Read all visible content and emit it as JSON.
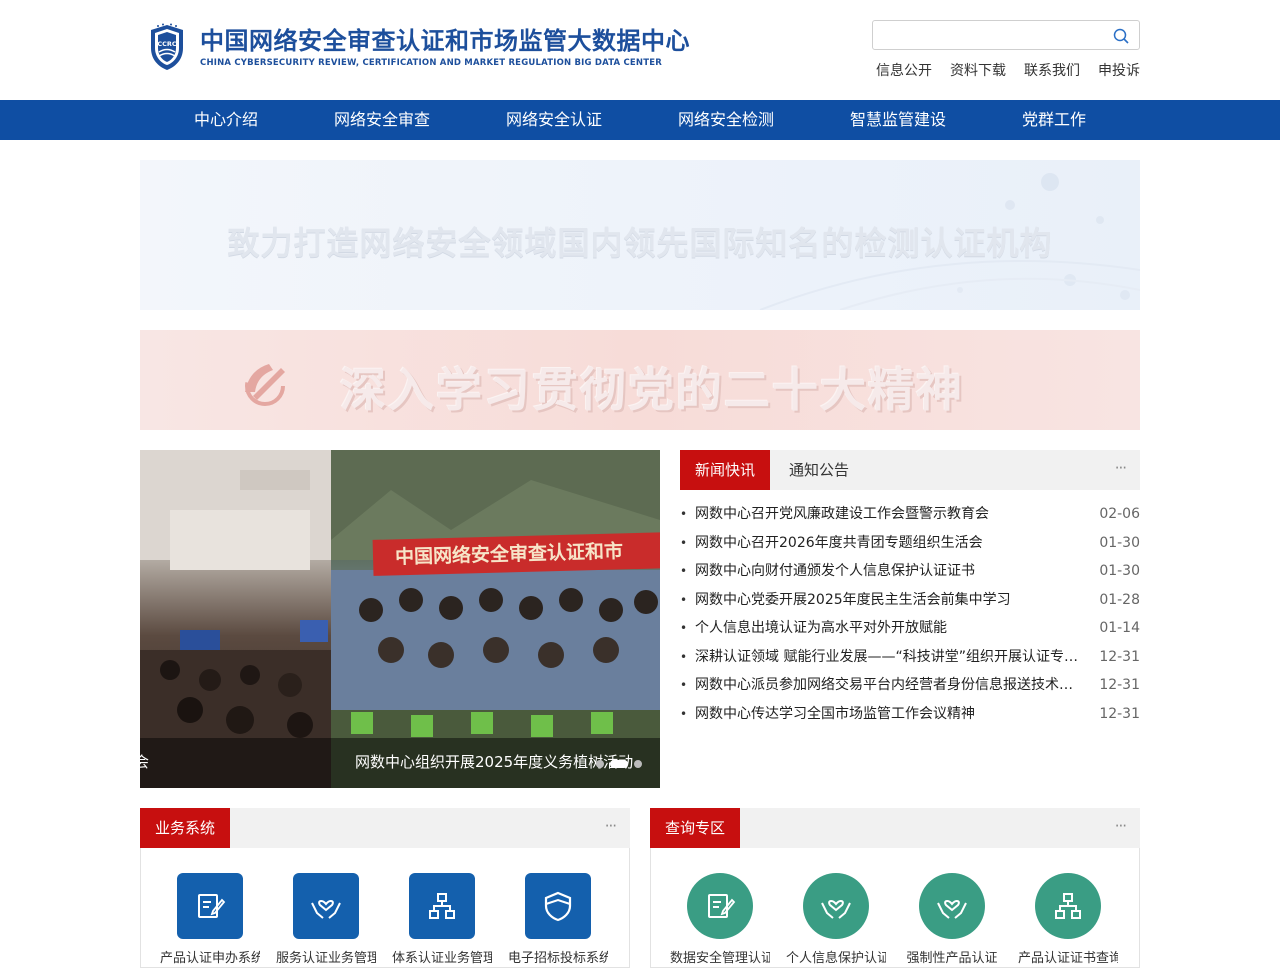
{
  "header": {
    "title_cn": "中国网络安全审查认证和市场监管大数据中心",
    "title_en": "CHINA CYBERSECURITY REVIEW, CERTIFICATION AND MARKET REGULATION BIG DATA CENTER",
    "logo_text": "CCRC",
    "search_placeholder": "",
    "top_links": [
      "信息公开",
      "资料下载",
      "联系我们",
      "申投诉"
    ]
  },
  "nav": [
    "中心介绍",
    "网络安全审查",
    "网络安全认证",
    "网络安全检测",
    "智慧监管建设",
    "党群工作"
  ],
  "banners": {
    "banner1_text": "致力打造网络安全领域国内领先国际知名的检测认证机构",
    "banner2_text": "深入学习贯彻党的二十大精神"
  },
  "slider": {
    "caption_a": "会",
    "caption_b": "网数中心组织开展2025年度义务植树活动",
    "slide_banner_text": "中国网络安全审查认证和市",
    "pages": 3,
    "active_page": 1
  },
  "news": {
    "tab_active": "新闻快讯",
    "tab_inactive": "通知公告",
    "more": "···",
    "items": [
      {
        "title": "网数中心召开党风廉政建设工作会暨警示教育会",
        "date": "02-06"
      },
      {
        "title": "网数中心召开2026年度共青团专题组织生活会",
        "date": "01-30"
      },
      {
        "title": "网数中心向财付通颁发个人信息保护认证证书",
        "date": "01-30"
      },
      {
        "title": "网数中心党委开展2025年度民主生活会前集中学习",
        "date": "01-28"
      },
      {
        "title": "个人信息出境认证为高水平对外开放赋能",
        "date": "01-14"
      },
      {
        "title": "深耕认证领域 赋能行业发展——“科技讲堂”组织开展认证专题讲座",
        "date": "12-31"
      },
      {
        "title": "网数中心派员参加网络交易平台内经营者身份信息报送技术培训",
        "date": "12-31"
      },
      {
        "title": "网数中心传达学习全国市场监管工作会议精神",
        "date": "12-31"
      }
    ]
  },
  "panels": {
    "business": {
      "tab": "业务系统",
      "more": "···",
      "tiles": [
        {
          "label": "产品认证申办系统",
          "icon": "edit-document-icon"
        },
        {
          "label": "服务认证业务管理",
          "icon": "hands-heart-icon"
        },
        {
          "label": "体系认证业务管理",
          "icon": "org-chart-icon"
        },
        {
          "label": "电子招标投标系统",
          "icon": "shield-icon"
        }
      ]
    },
    "query": {
      "tab": "查询专区",
      "more": "···",
      "tiles": [
        {
          "label": "数据安全管理认证",
          "icon": "edit-document-icon"
        },
        {
          "label": "个人信息保护认证",
          "icon": "hands-heart-icon"
        },
        {
          "label": "强制性产品认证",
          "icon": "hands-heart-icon"
        },
        {
          "label": "产品认证证书查询",
          "icon": "org-chart-icon"
        }
      ]
    }
  },
  "colors": {
    "brand_blue": "#0f4ea3",
    "accent_red": "#c70f0f",
    "tile_blue": "#1460ad",
    "tile_green": "#3a9d84"
  }
}
